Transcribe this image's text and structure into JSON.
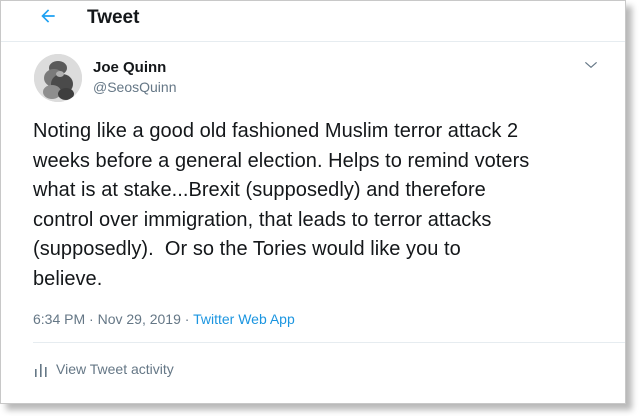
{
  "header": {
    "title": "Tweet",
    "back_icon": "arrow-left-icon"
  },
  "tweet": {
    "author": {
      "name": "Joe Quinn",
      "handle": "@SeosQuinn",
      "avatar_icon": "profile-photo"
    },
    "more_icon": "chevron-down-icon",
    "text": "Noting like a good old fashioned Muslim terror attack 2\nweeks before a general election. Helps to remind voters\nwhat is at stake...Brexit (supposedly) and therefore\ncontrol over immigration, that leads to terror attacks\n(supposedly).  Or so the Tories would like you to\nbelieve.",
    "timestamp": "6:34 PM · Nov 29, 2019",
    "separator": " · ",
    "source": "Twitter Web App",
    "activity_label": "View Tweet activity",
    "activity_icon": "bar-chart-icon"
  },
  "colors": {
    "accent": "#1b95e0",
    "text_primary": "#14171a",
    "text_secondary": "#657786",
    "divider": "#e6ecf0"
  }
}
